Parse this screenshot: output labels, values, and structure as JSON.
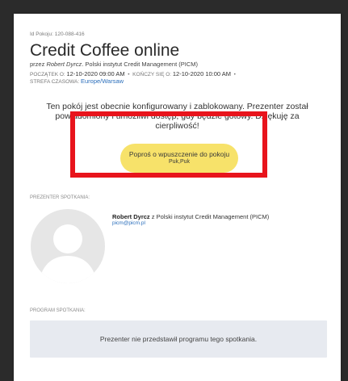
{
  "room": {
    "id_label": "Id Pokoju: 120-088-416",
    "title": "Credit Coffee online",
    "by_prefix": "przez",
    "presenter_name": "Robert Dyrcz",
    "organization": ". Polski instytut Credit Management (PICM)"
  },
  "schedule": {
    "start_label": "POCZĄTEK O:",
    "start_value": "12-10-2020 09:00 AM",
    "end_label": "KOŃCZY SIĘ O:",
    "end_value": "12-10-2020 10:00 AM",
    "tz_label": "STREFA CZASOWA:",
    "tz_value": "Europe/Warsaw"
  },
  "notice": {
    "text": "Ten pokój jest obecnie konfigurowany i zablokowany. Prezenter został powiadomiony i umożliwi dostęp, gdy będzie gotowy. Dziękuję za cierpliwość!"
  },
  "knock_button": {
    "label": "Poproś o wpuszczenie do pokoju",
    "sublabel": "Puk,Puk"
  },
  "presenter_section": {
    "label": "PREZENTER SPOTKANIA:",
    "name": "Robert Dyrcz",
    "affiliation": " z Polski instytut Credit Management (PICM)",
    "email": "picm@picm.pl"
  },
  "program_section": {
    "label": "PROGRAM SPOTKANIA:",
    "empty_text": "Prezenter nie przedstawił programu tego spotkania."
  },
  "colors": {
    "button_yellow": "#f7e26a",
    "highlight_red": "#e8141c",
    "link_blue": "#2a6ebb",
    "program_bg": "#e7eaf0"
  },
  "icons": {
    "avatar": "default-user-silhouette"
  }
}
